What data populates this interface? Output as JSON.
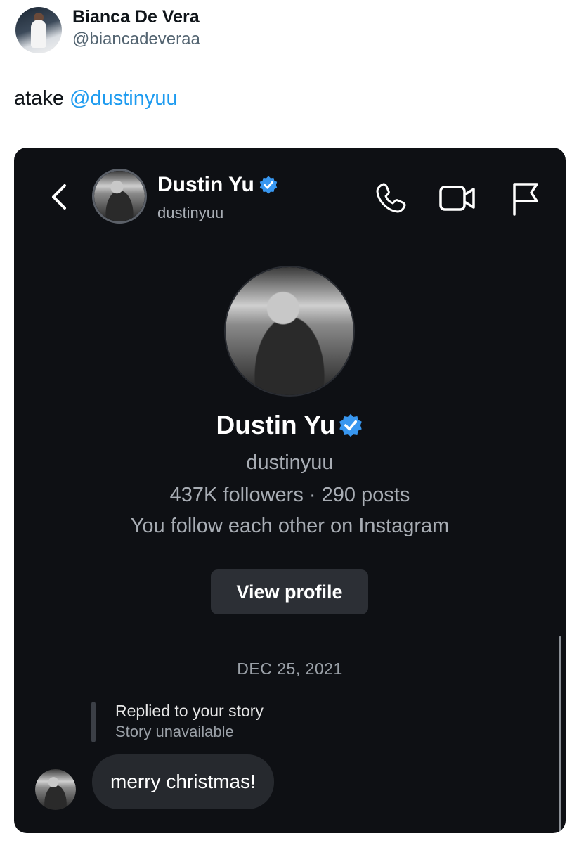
{
  "tweet": {
    "author_name": "Bianca De Vera",
    "author_handle": "@biancadeveraa",
    "text_prefix": "atake",
    "mention": "@dustinyuu"
  },
  "dm": {
    "header": {
      "name": "Dustin Yu",
      "username": "dustinyuu"
    },
    "profile": {
      "name": "Dustin Yu",
      "username": "dustinyuu",
      "stats": "437K followers · 290 posts",
      "mutual": "You follow each other on Instagram",
      "view_profile_label": "View profile"
    },
    "date_separator": "DEC 25, 2021",
    "reply": {
      "title": "Replied to your story",
      "subtitle": "Story unavailable"
    },
    "message": "merry christmas!"
  },
  "icons": {
    "back": "chevron-left-icon",
    "phone": "phone-icon",
    "video": "video-camera-icon",
    "flag": "flag-icon",
    "verified": "verified-badge-icon"
  },
  "colors": {
    "mention": "#1d9bf0",
    "verified": "#3897f0",
    "card_bg": "#0e1014",
    "bubble_bg": "#26292e",
    "button_bg": "#2c2f35"
  }
}
